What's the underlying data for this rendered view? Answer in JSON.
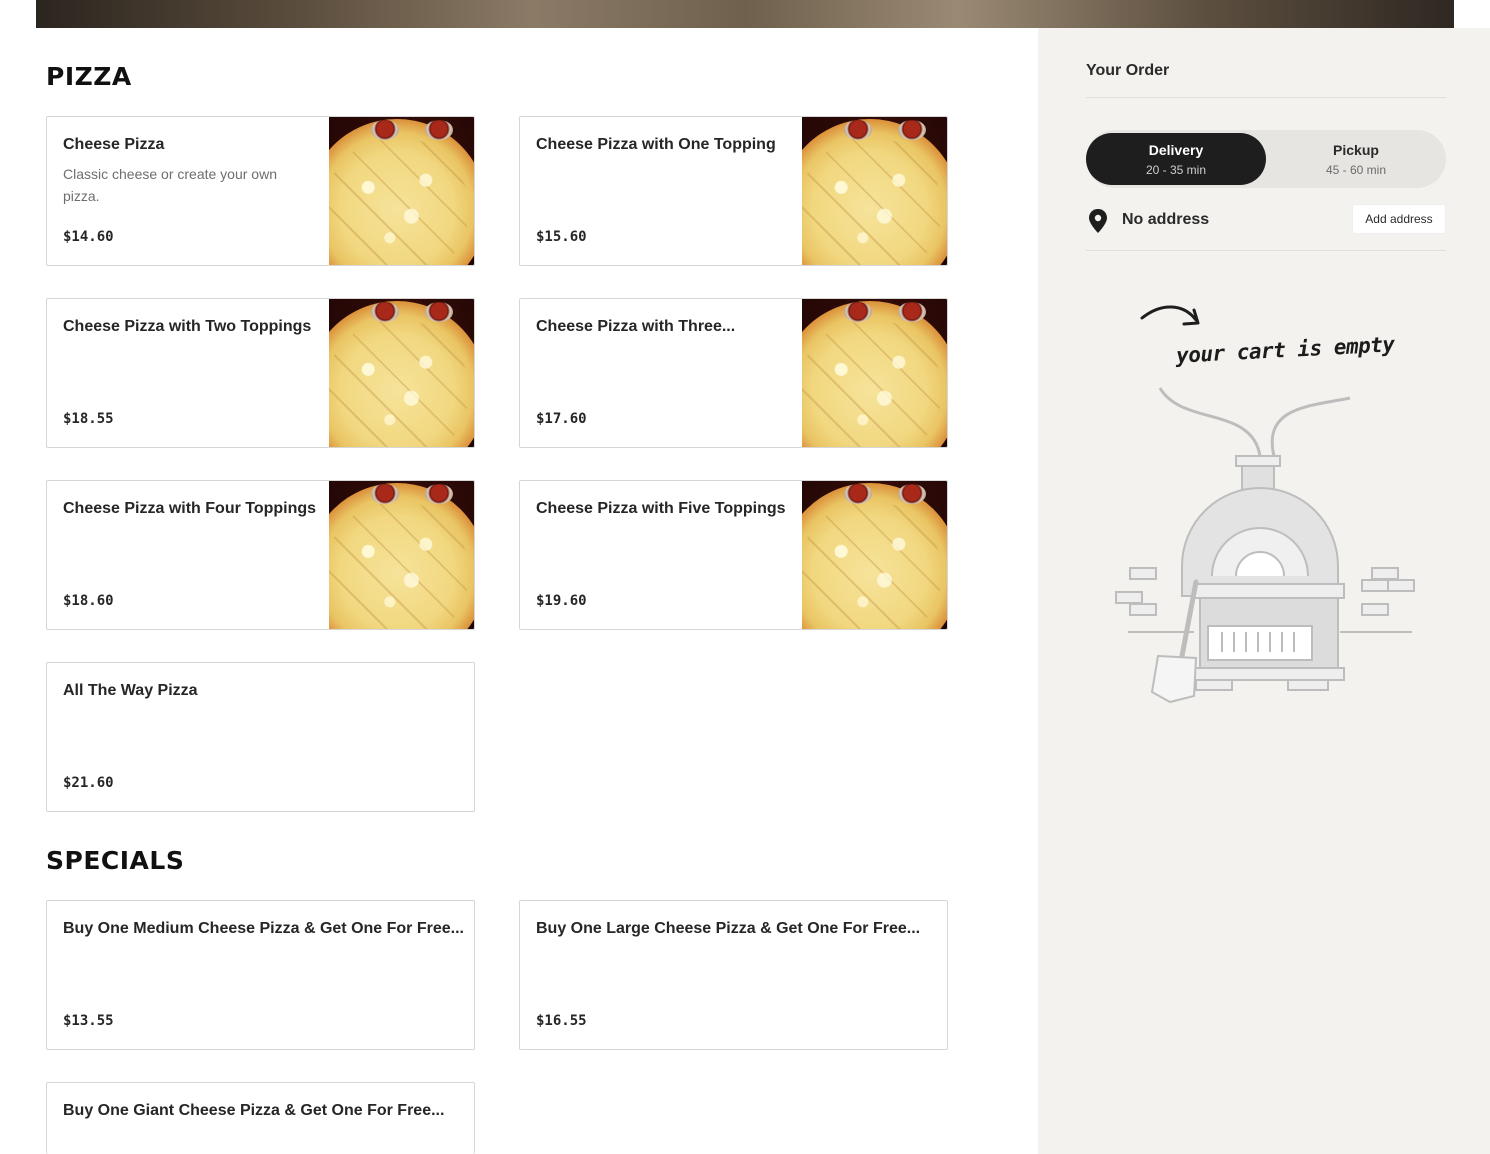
{
  "sections": [
    {
      "title": "PIZZA",
      "items": [
        {
          "name": "Cheese Pizza",
          "description": "Classic cheese or create your own pizza.",
          "price": "$14.60",
          "image": "cheese-pizza-photo"
        },
        {
          "name": "Cheese Pizza with One Topping",
          "description": "",
          "price": "$15.60",
          "image": "cheese-pizza-photo"
        },
        {
          "name": "Cheese Pizza with Two Toppings",
          "description": "",
          "price": "$18.55",
          "image": "cheese-pizza-photo"
        },
        {
          "name": "Cheese Pizza with Three...",
          "description": "",
          "price": "$17.60",
          "image": "cheese-pizza-photo"
        },
        {
          "name": "Cheese Pizza with Four Toppings",
          "description": "",
          "price": "$18.60",
          "image": "cheese-pizza-photo"
        },
        {
          "name": "Cheese Pizza with Five Toppings",
          "description": "",
          "price": "$19.60",
          "image": "cheese-pizza-photo"
        },
        {
          "name": "All The Way Pizza",
          "description": "",
          "price": "$21.60",
          "image": ""
        }
      ]
    },
    {
      "title": "SPECIALS",
      "items": [
        {
          "name": "Buy One Medium Cheese Pizza & Get One For Free...",
          "description": "",
          "price": "$13.55",
          "image": ""
        },
        {
          "name": "Buy One Large Cheese Pizza & Get One For Free...",
          "description": "",
          "price": "$16.55",
          "image": ""
        },
        {
          "name": "Buy One Giant Cheese Pizza & Get One For Free...",
          "description": "",
          "price": "",
          "image": ""
        }
      ]
    }
  ],
  "order": {
    "title": "Your Order",
    "delivery": {
      "label": "Delivery",
      "time": "20 - 35 min",
      "selected": true
    },
    "pickup": {
      "label": "Pickup",
      "time": "45 - 60 min",
      "selected": false
    },
    "address": {
      "icon": "location-pin-icon",
      "text": "No address",
      "button": "Add address"
    },
    "empty_cart_text": "your cart is empty",
    "empty_cart_illustration": "pizza-oven-illustration"
  },
  "colors": {
    "sidebar_bg": "#f3f2ef",
    "toggle_active": "#1e1e1e",
    "card_border": "#d6d6d6"
  }
}
